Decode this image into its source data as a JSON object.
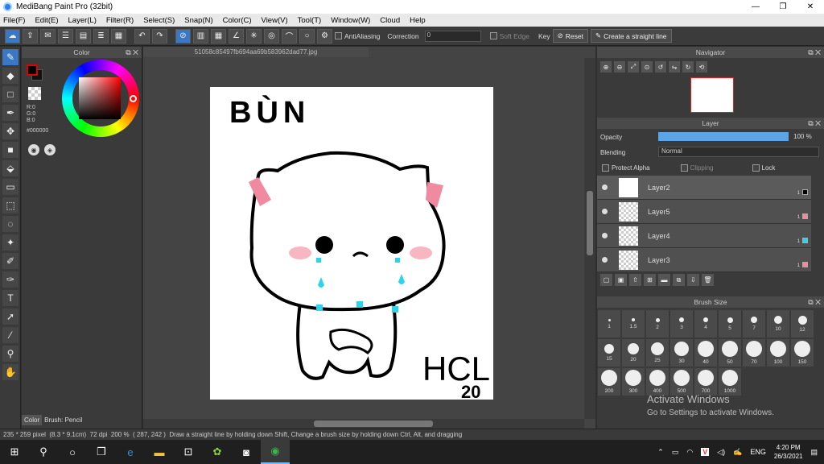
{
  "window": {
    "title": "MediBang Paint Pro (32bit)",
    "minimize": "—",
    "restore": "❐",
    "close": "✕"
  },
  "menu": [
    "File(F)",
    "Edit(E)",
    "Layer(L)",
    "Filter(R)",
    "Select(S)",
    "Snap(N)",
    "Color(C)",
    "View(V)",
    "Tool(T)",
    "Window(W)",
    "Cloud",
    "Help"
  ],
  "toolbar": {
    "antialiasing": "AntiAliasing",
    "correction_label": "Correction",
    "correction_value": "0",
    "soft_edge": "Soft Edge",
    "key": "Key",
    "reset": "Reset",
    "straight_line": "Create a straight line"
  },
  "color_panel": {
    "title": "Color",
    "r": "R:0",
    "g": "G:0",
    "b": "B:0",
    "hex": "#000000",
    "fg_color": "#000000"
  },
  "bottom_tabs": {
    "color": "Color",
    "brush": "Brush: Pencil"
  },
  "document": {
    "tab": "51058c85497fb694aa69b583962dad77.jpg"
  },
  "drawing": {
    "title_text": "BÙN",
    "signature": "HCL",
    "year": "20"
  },
  "navigator": {
    "title": "Navigator"
  },
  "layer_panel": {
    "title": "Layer",
    "opacity_label": "Opacity",
    "opacity_value": "100 %",
    "opacity_fraction": 1.0,
    "blending_label": "Blending",
    "blending_value": "Normal",
    "protect_alpha": "Protect Alpha",
    "clipping": "Clipping",
    "lock": "Lock",
    "layers": [
      {
        "name": "Layer2",
        "num": "1",
        "color": "#000000"
      },
      {
        "name": "Layer5",
        "num": "1",
        "color": "#f08aa0"
      },
      {
        "name": "Layer4",
        "num": "1",
        "color": "#2ad4ea"
      },
      {
        "name": "Layer3",
        "num": "1",
        "color": "#f08aa0"
      }
    ]
  },
  "brush_size": {
    "title": "Brush Size",
    "sizes": [
      "1",
      "1.5",
      "2",
      "3",
      "4",
      "5",
      "7",
      "10",
      "12",
      "15",
      "20",
      "25",
      "30",
      "40",
      "50",
      "70",
      "100",
      "150",
      "200",
      "300",
      "400",
      "500",
      "700",
      "1000"
    ]
  },
  "watermark": {
    "line1": "Activate Windows",
    "line2": "Go to Settings to activate Windows."
  },
  "status": {
    "dims": "235 * 259 pixel",
    "size": "(8.3 * 9.1cm)",
    "dpi": "72 dpi",
    "zoom": "200 %",
    "coords": "( 287, 242 )",
    "hint": "Draw a straight line by holding down Shift, Change a brush size by holding down Ctrl, Alt, and dragging"
  },
  "taskbar": {
    "lang": "ENG",
    "time": "4:20 PM",
    "date": "26/3/2021"
  }
}
